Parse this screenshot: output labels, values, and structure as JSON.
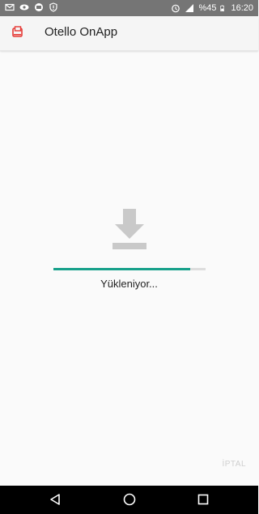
{
  "status_bar": {
    "battery_text": "%45",
    "time": "16:20",
    "icons": [
      "gmail-icon",
      "eye-icon",
      "cast-icon",
      "shield-icon",
      "alarm-icon",
      "signal-icon",
      "battery-icon"
    ]
  },
  "app_bar": {
    "title": "Otello OnApp",
    "icon": "app-logo-icon"
  },
  "download": {
    "icon": "download-icon",
    "progress": 0.9,
    "status_text": "Yükleniyor..."
  },
  "cancel_label": "İPTAL",
  "nav_bar": {
    "buttons": [
      "back-icon",
      "home-icon",
      "recents-icon"
    ]
  },
  "colors": {
    "status_bar": "#757575",
    "accent": "#17a08a",
    "app_icon": "#e53935"
  }
}
